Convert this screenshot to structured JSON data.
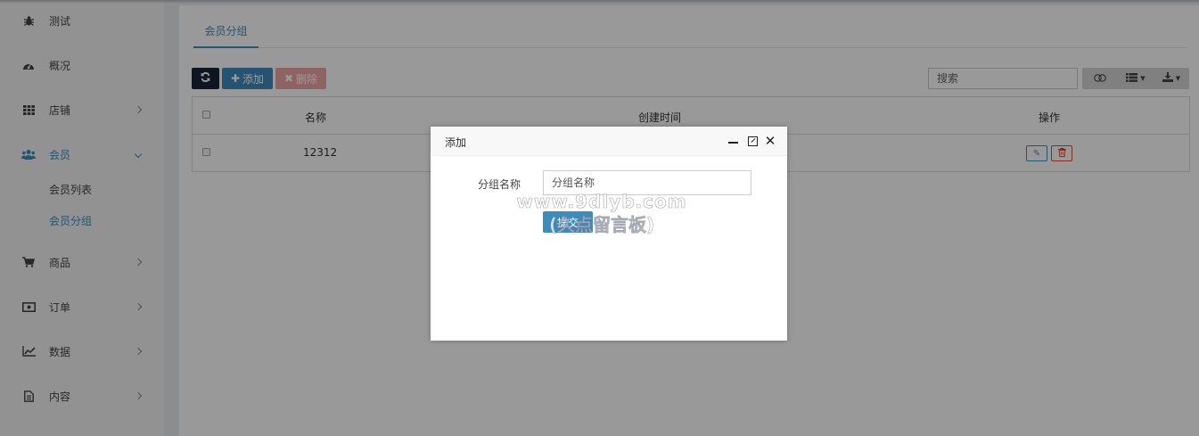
{
  "sidebar": {
    "items": [
      {
        "label": "测试",
        "icon": "bug-icon"
      },
      {
        "label": "概况",
        "icon": "dashboard-icon"
      },
      {
        "label": "店铺",
        "icon": "grid-icon"
      },
      {
        "label": "会员",
        "icon": "users-icon",
        "active": true
      },
      {
        "label": "商品",
        "icon": "cart-icon"
      },
      {
        "label": "订单",
        "icon": "money-icon"
      },
      {
        "label": "数据",
        "icon": "line-chart-icon"
      },
      {
        "label": "内容",
        "icon": "file-icon"
      }
    ],
    "sub_items": [
      {
        "label": "会员列表"
      },
      {
        "label": "会员分组",
        "active": true
      }
    ]
  },
  "tabs": [
    {
      "label": "会员分组",
      "active": true
    }
  ],
  "toolbar": {
    "refresh_icon": "refresh-icon",
    "add_label": "添加",
    "delete_label": "删除",
    "search_placeholder": "搜索"
  },
  "table": {
    "columns": [
      "名称",
      "创建时间",
      "操作"
    ],
    "rows": [
      {
        "name": "12312"
      }
    ]
  },
  "modal": {
    "title": "添加",
    "field_label": "分组名称",
    "field_placeholder": "分组名称",
    "submit_label": "提交"
  },
  "watermark": {
    "line1": "www.9dlyb.com",
    "line2": "(久点留言板)"
  },
  "colors": {
    "accent": "#3c8dbc",
    "danger": "#dd4b39",
    "dark": "#18253a"
  }
}
